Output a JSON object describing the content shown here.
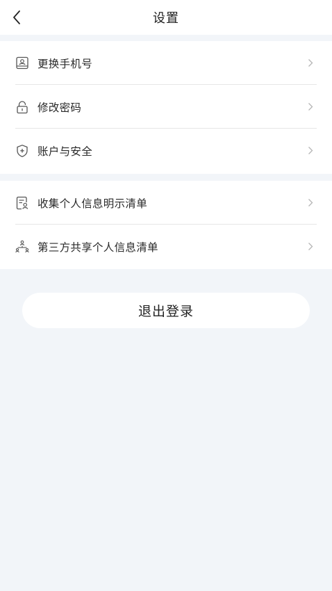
{
  "header": {
    "title": "设置",
    "back_icon": "chevron-left-icon"
  },
  "groups": [
    {
      "items": [
        {
          "label": "更换手机号",
          "icon": "phone-icon"
        },
        {
          "label": "修改密码",
          "icon": "lock-icon"
        },
        {
          "label": "账户与安全",
          "icon": "shield-icon"
        }
      ]
    },
    {
      "items": [
        {
          "label": "收集个人信息明示清单",
          "icon": "document-person-icon"
        },
        {
          "label": "第三方共享个人信息清单",
          "icon": "share-network-icon"
        }
      ]
    }
  ],
  "logout": {
    "label": "退出登录"
  },
  "colors": {
    "background": "#f2f5f9",
    "card": "#ffffff",
    "text": "#222222",
    "icon": "#555555",
    "chevron": "#b5b5b5"
  }
}
